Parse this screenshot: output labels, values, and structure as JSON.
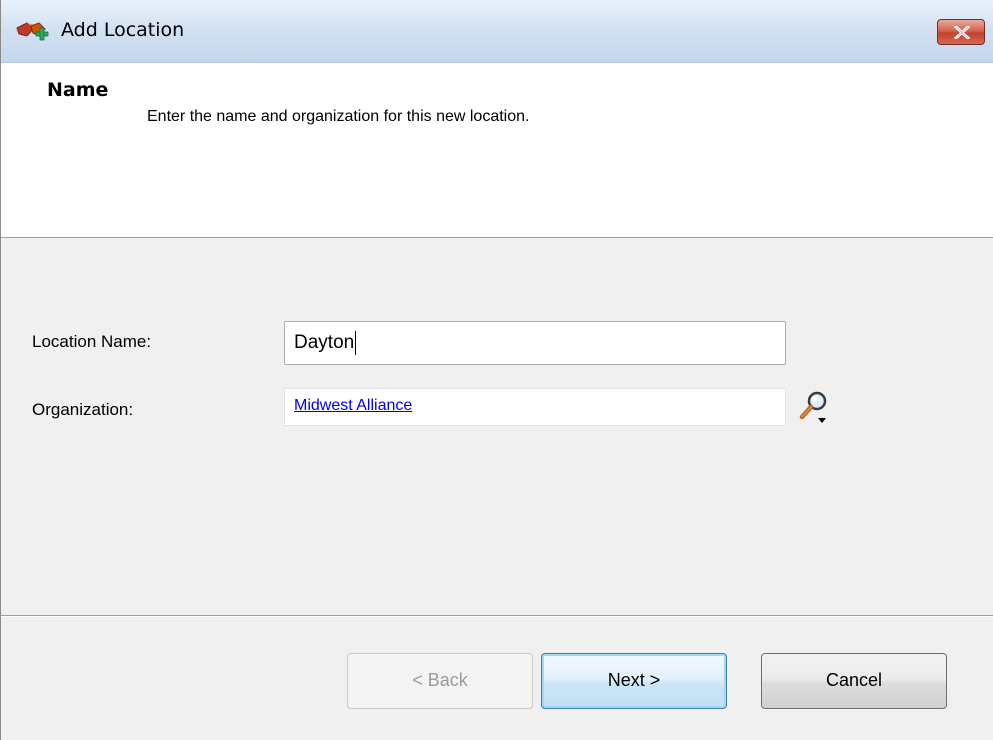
{
  "window": {
    "title": "Add Location",
    "close_label": "x"
  },
  "header": {
    "title": "Name",
    "description": "Enter the name and organization for this new location."
  },
  "form": {
    "location_name_label": "Location Name:",
    "location_name_value": "Dayton",
    "organization_label": "Organization:",
    "organization_value": "Midwest Alliance"
  },
  "buttons": {
    "back": "< Back",
    "next": "Next >",
    "cancel": "Cancel"
  },
  "icons": {
    "app": "location-add-icon",
    "lookup": "magnifier-dropdown-icon",
    "close": "close-icon"
  },
  "colors": {
    "link": "#0000ee",
    "close_button": "#c1432f",
    "default_button_border": "#3c7fb1"
  }
}
